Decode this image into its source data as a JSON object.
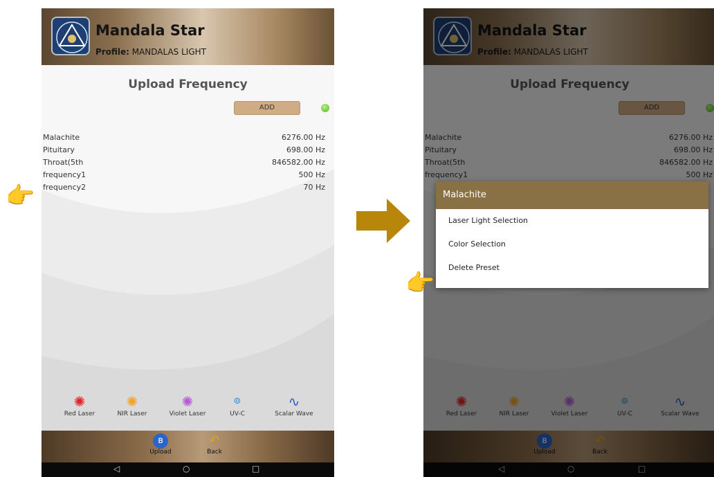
{
  "app": {
    "title": "Mandala Star",
    "profile_label": "Profile:",
    "profile_value": "MANDALAS LIGHT"
  },
  "page_title": "Upload Frequency",
  "add_button": "ADD",
  "presets": [
    {
      "name": "Malachite",
      "freq": "6276.00 Hz"
    },
    {
      "name": "Pituitary",
      "freq": "698.00 Hz"
    },
    {
      "name": "Throat(5th",
      "freq": "846582.00 Hz"
    },
    {
      "name": "frequency1",
      "freq": "500 Hz"
    },
    {
      "name": "frequency2",
      "freq": "70 Hz"
    }
  ],
  "lasers": [
    {
      "label": "Red Laser",
      "icon": "starburst-icon",
      "color": "#e0242b"
    },
    {
      "label": "NIR Laser",
      "icon": "starburst-icon",
      "color": "#f3a52a"
    },
    {
      "label": "Violet Laser",
      "icon": "starburst-icon",
      "color": "#b85ad8"
    },
    {
      "label": "UV-C",
      "icon": "uvc-icon",
      "color": "#2c8ee0"
    },
    {
      "label": "Scalar Wave",
      "icon": "wave-icon",
      "color": "#2a5bd0"
    }
  ],
  "bottom": {
    "upload": "Upload",
    "back": "Back"
  },
  "nav": {
    "back": "◁",
    "home": "○",
    "recent": "□"
  },
  "dialog": {
    "title": "Malachite",
    "options": [
      "Laser Light Selection",
      "Color Selection",
      "Delete Preset"
    ]
  },
  "colors": {
    "accent": "#8a7045",
    "add": "#d0ac85",
    "arrow": "#b8860b"
  }
}
